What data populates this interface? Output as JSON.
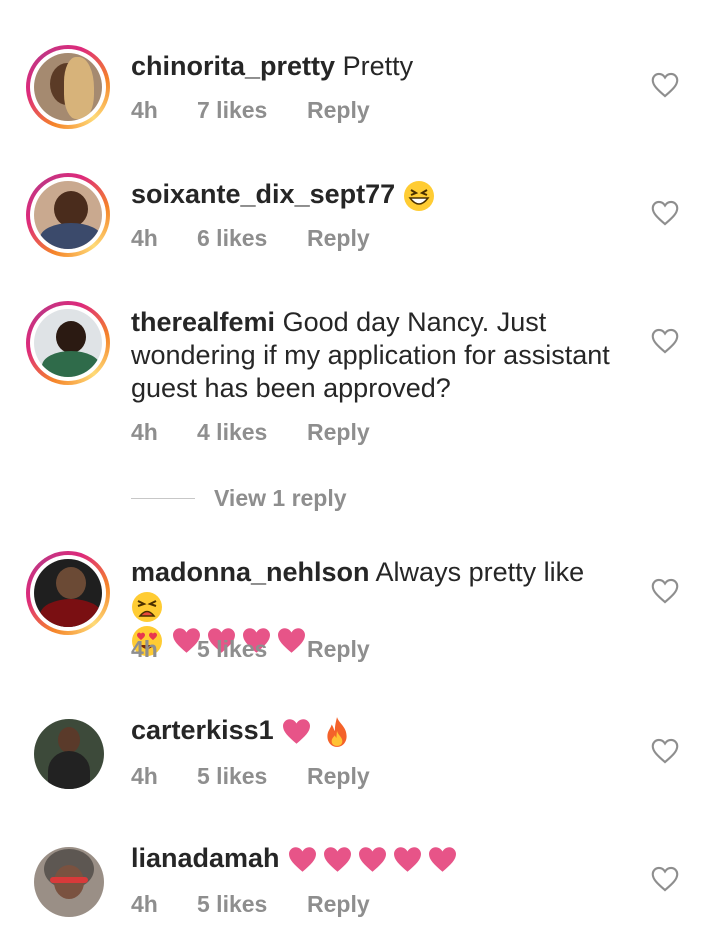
{
  "comments": [
    {
      "username": "chinorita_pretty",
      "text": "Pretty",
      "time": "4h",
      "likes": "7 likes",
      "reply": "Reply"
    },
    {
      "username": "soixante_dix_sept77",
      "text": "",
      "time": "4h",
      "likes": "6 likes",
      "reply": "Reply"
    },
    {
      "username": "therealfemi",
      "text": "Good day Nancy. Just wondering if my application for assistant guest has been approved?",
      "time": "4h",
      "likes": "4 likes",
      "reply": "Reply"
    },
    {
      "username": "madonna_nehlson",
      "text": "Always pretty like",
      "time": "4h",
      "likes": "5 likes",
      "reply": "Reply"
    },
    {
      "username": "carterkiss1",
      "text": "",
      "time": "4h",
      "likes": "5 likes",
      "reply": "Reply"
    },
    {
      "username": "lianadamah",
      "text": "",
      "time": "4h",
      "likes": "5 likes",
      "reply": "Reply"
    }
  ],
  "view_replies": "View 1 reply",
  "colors": {
    "heart_pink": "#e75488",
    "meta_gray": "#8e8e8e",
    "text": "#262626"
  },
  "icons": [
    "heart-outline-icon",
    "grinning-squint-emoji",
    "pink-heart-emoji",
    "fire-emoji",
    "tired-face-emoji",
    "heart-eyes-emoji"
  ]
}
